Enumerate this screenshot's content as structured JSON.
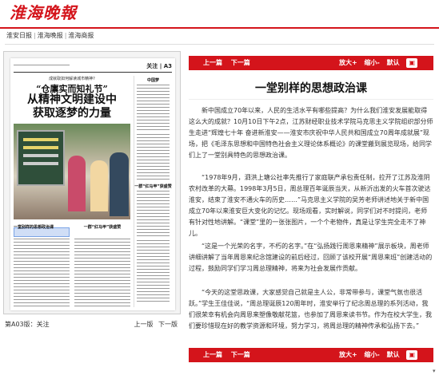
{
  "masthead": {
    "logo_text": "淮海晚報"
  },
  "nav": {
    "items": [
      "淮安日报",
      "淮海晚报",
      "淮海商报"
    ],
    "separator": "|"
  },
  "paper": {
    "section_label": "关注 | A3",
    "kicker": "成就取如何解读城市精神?",
    "headline1": "“仓廪实而知礼节”",
    "headline2_line1": "从精神文明建设中",
    "headline2_line2": "获取逐梦的力量",
    "side_head1": "中国梦",
    "side_head2": "一群“红马甲”获盛赞",
    "sub_left": "一堂别样的思想政治课",
    "sub_right": "一群“红马甲”获盛赞"
  },
  "pager": {
    "page_label": "第A03版：关注",
    "prev": "上一版",
    "next": "下一版"
  },
  "toolbar": {
    "prev": "上一篇",
    "next": "下一篇",
    "zoom_in": "放大+",
    "zoom_out": "缩小-",
    "default": "默认",
    "go": "▣"
  },
  "article": {
    "title": "一堂别样的思想政治课",
    "paragraphs": [
      "新中国成立70年以来，人民的生活水平有哪些提高？为什么我们淮安发展能取得这么大的成就？10月10日下午2点，江苏财经职业技术学院马克思主义学院组织部分师生走进“辉煌七十年 奋进新淮安——淮安市庆祝中华人民共和国成立70周年成就展”现场，把《毛泽东思想和中国特色社会主义理论体系概论》的课堂搬到展览现场，给同学们上了一堂别具特色的思想政治课。",
      "“1978年9月，泗洪上塘公社率先推行了家庭联产承包责任制，拉开了江苏及淮阴农村改革的大幕。1998年3月5日，周总理百年诞辰当天，从新沂出发的火车首次驶达淮安，结束了淮安不通火车的历史……”马克思主义学院的吴芳老师讲述地关于新中国成立70年以来淮安巨大变化的记忆。现场观看，实时解说，同学们对不时提问，老师有针对性地讲解。“课堂”里的一张张图片，一个个老物件，真是让学生完全走不了神儿。",
      "“这是一个光荣的名字，不朽的名字。”在“弘扬践行周恩来精神”展示板块，周老师讲细讲解了当年周恩来纪念馆建设的前后经过，回顾了该校开展“周恩来班”创建活动的过程，鼓励同学们学习周总理精神，将来为社会发展作贡献。",
      "“今天的这堂思政课，大家感觉自己就是主人公，非常带参与，课堂气氛也很活跃。”学生王佳佳说，“周总理诞辰120周年时，淮安举行了纪念周总理的系列活动，我们很荣幸有机会向周恩来塑像敬献花篮，也参加了周恩来读书节。作为在校大学生，我们要珍惜现在好的教学资源和环境，努力学习，将周总理的精神传承和弘扬下去。”"
    ]
  }
}
